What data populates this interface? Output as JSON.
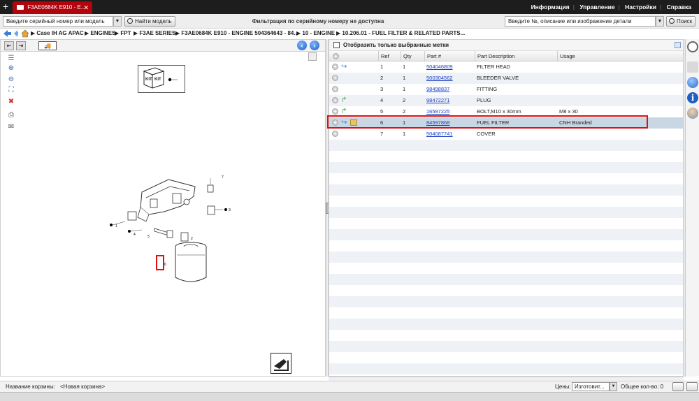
{
  "top_bar": {
    "tab_title": "F3AE0684K E910 - E...",
    "menu": [
      "Информация",
      "Управление",
      "Настройки",
      "Справка"
    ]
  },
  "search_bar": {
    "serial_placeholder": "Введите серийный номер или модель",
    "find_model_label": "Найти модель",
    "filter_message": "Фильтрация по серийному номеру не доступна",
    "part_search_placeholder": "Введите №, описание или изображение детали",
    "search_label": "Поиск"
  },
  "breadcrumb": [
    "Case IH AG APAC",
    "ENGINES",
    "FPT",
    "F3AE SERIES",
    "F3AE0684K E910 - ENGINE 504364643 - 84...",
    "10 - ENGINE",
    "10.206.01 - FUEL FILTER & RELATED PARTS..."
  ],
  "diagram": {
    "kit_label": "KIT",
    "callouts": [
      "1",
      "2",
      "3",
      "4",
      "5",
      "6",
      "7"
    ]
  },
  "parts_panel": {
    "show_selected_label": "Отобразить только выбранные метки",
    "columns": [
      "Ref",
      "Qty",
      "Part #",
      "Part Description",
      "Usage"
    ],
    "rows": [
      {
        "ref": "1",
        "qty": "1",
        "part": "504046809",
        "desc": "FILTER HEAD",
        "usage": "",
        "icon": "arrow-blue"
      },
      {
        "ref": "2",
        "qty": "1",
        "part": "500304562",
        "desc": "BLEEDER VALVE",
        "usage": "",
        "icon": ""
      },
      {
        "ref": "3",
        "qty": "1",
        "part": "98498837",
        "desc": "FITTING",
        "usage": "",
        "icon": ""
      },
      {
        "ref": "4",
        "qty": "2",
        "part": "98472271",
        "desc": "PLUG",
        "usage": "",
        "icon": "arrow-green"
      },
      {
        "ref": "5",
        "qty": "2",
        "part": "16587225",
        "desc": "BOLT,M10 x 30mm",
        "usage": "M8 x 30",
        "icon": "arrow-green"
      },
      {
        "ref": "6",
        "qty": "1",
        "part": "84597868",
        "desc": "FUEL FILTER",
        "usage": "CNH Branded",
        "icon": "arrow-blue"
      },
      {
        "ref": "7",
        "qty": "1",
        "part": "504087741",
        "desc": "COVER",
        "usage": "",
        "icon": ""
      }
    ]
  },
  "status_bar": {
    "cart_label": "Название корзины:",
    "cart_name": "<Новая корзина>",
    "prices_label": "Цены:",
    "prices_value": "Изготовит...",
    "total_label": "Общее кол-во: 0"
  }
}
